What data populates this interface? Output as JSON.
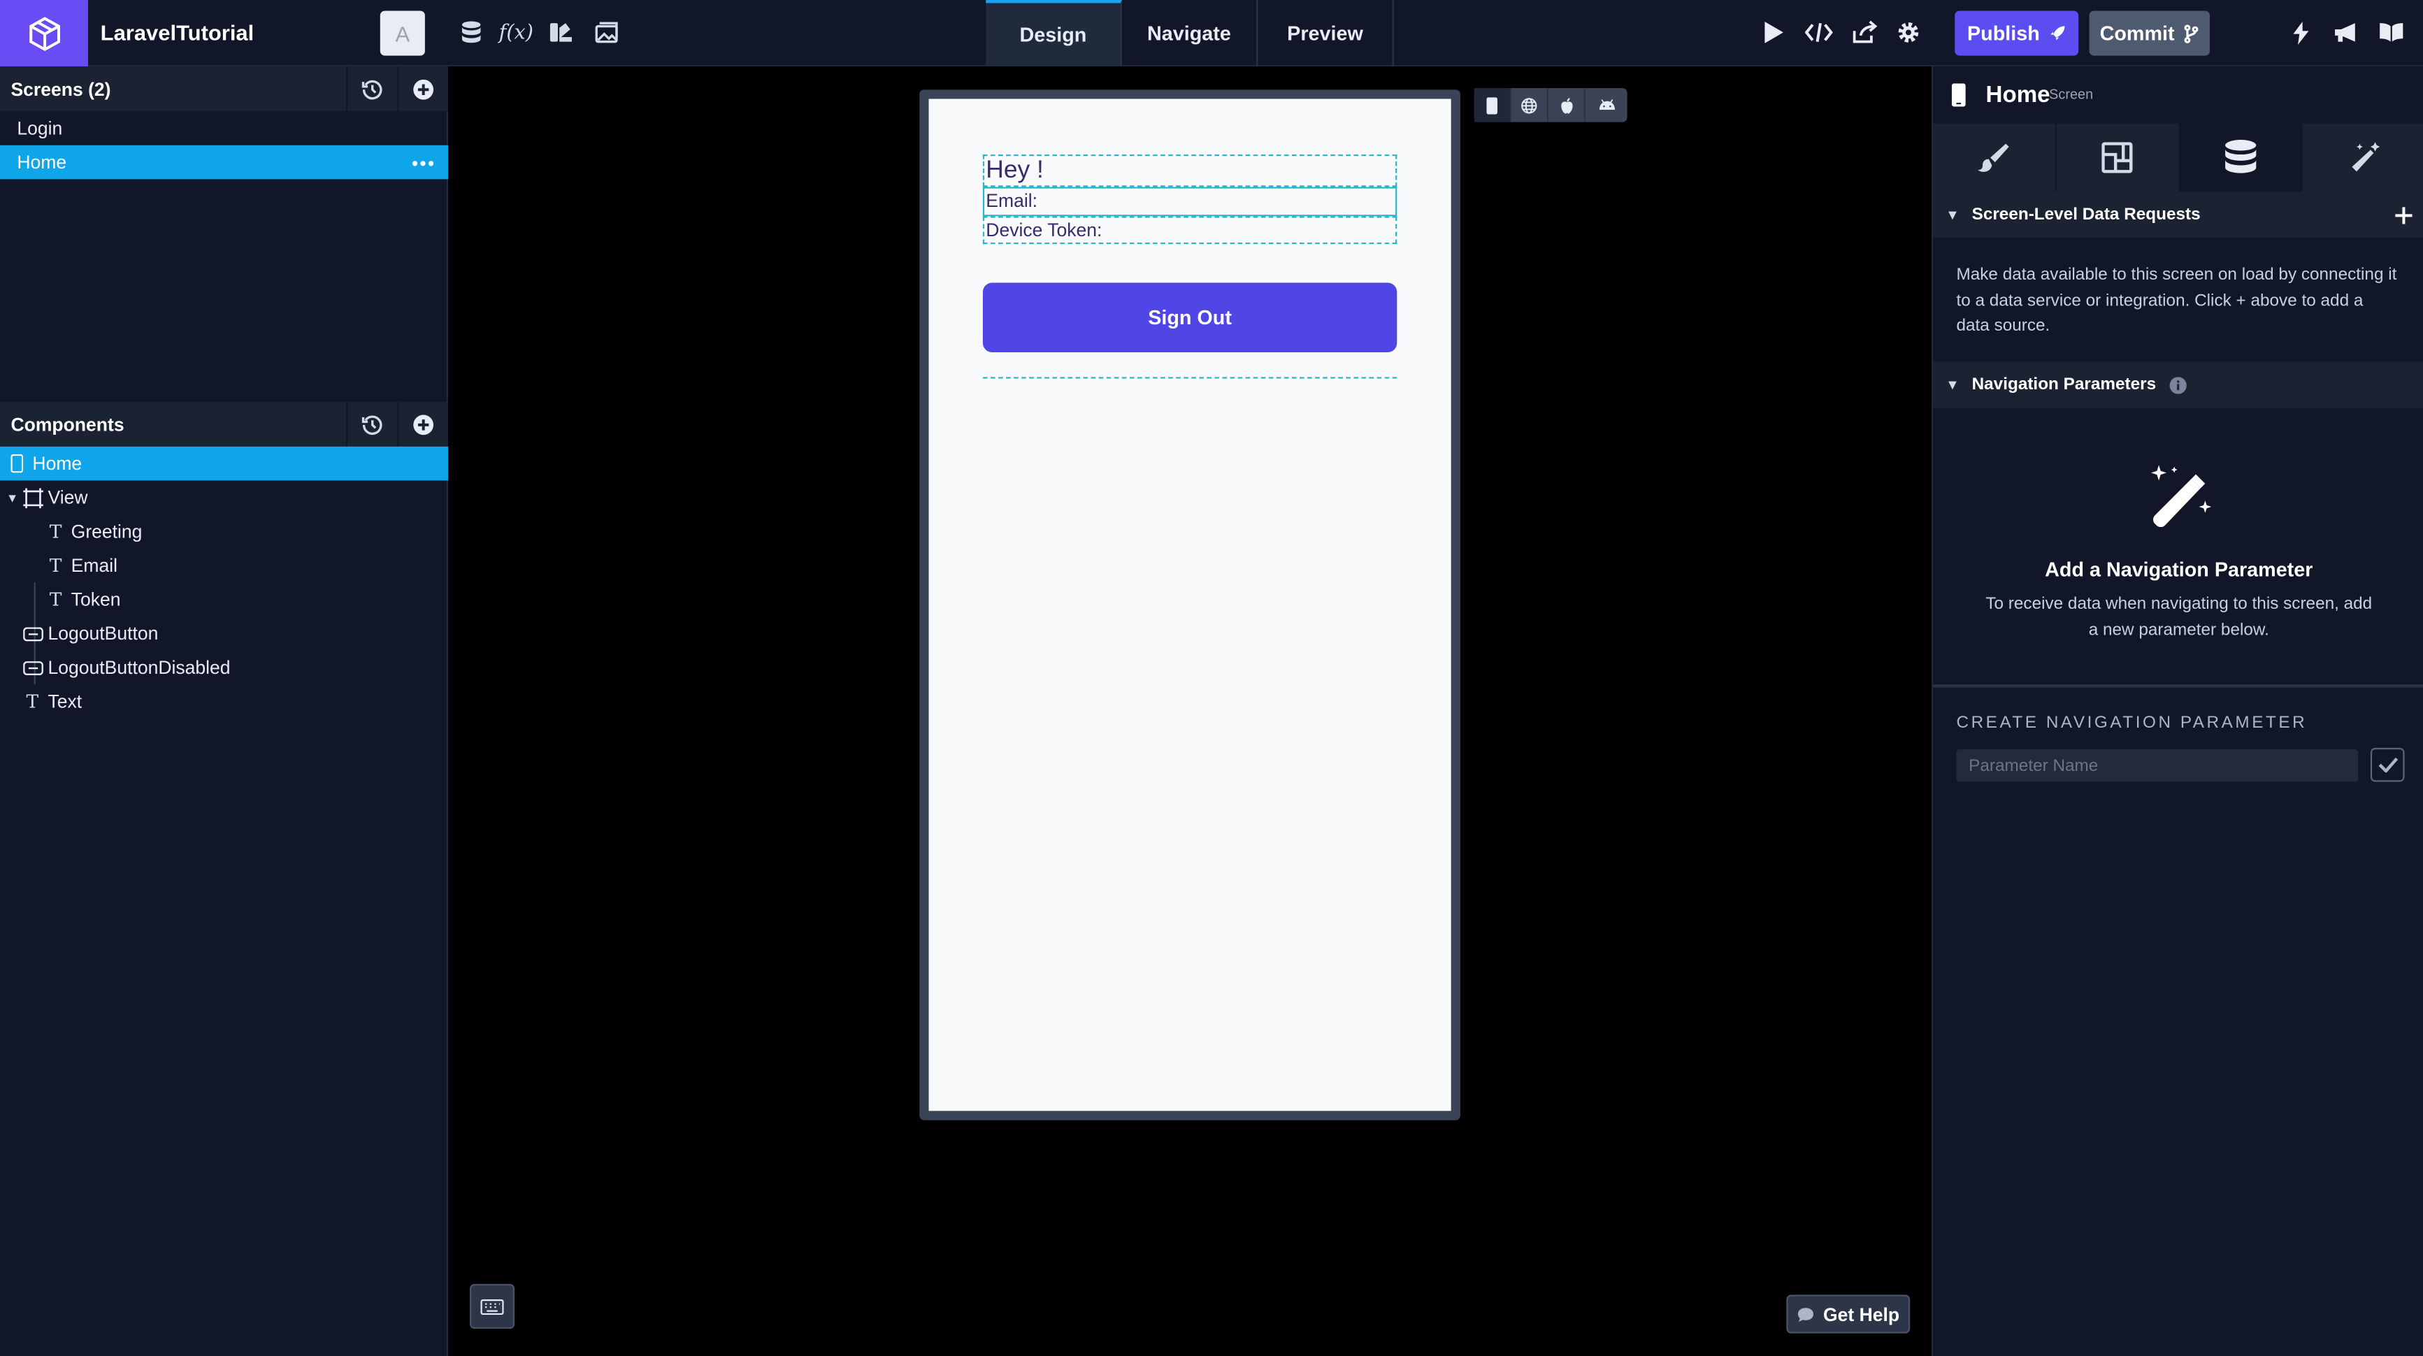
{
  "app": {
    "title": "LaravelTutorial",
    "avatar_initial": "A"
  },
  "toolbar": {
    "icons": [
      "database-icon",
      "function-icon",
      "theme-icon",
      "image-icon"
    ],
    "tabs": [
      {
        "label": "Design",
        "active": true
      },
      {
        "label": "Navigate",
        "active": false
      },
      {
        "label": "Preview",
        "active": false
      }
    ],
    "publish_label": "Publish",
    "commit_label": "Commit"
  },
  "screens": {
    "title": "Screens (2)",
    "items": [
      {
        "label": "Login",
        "selected": false
      },
      {
        "label": "Home",
        "selected": true
      }
    ]
  },
  "components": {
    "title": "Components",
    "items": [
      {
        "label": "Home",
        "type": "screen",
        "selected": true
      },
      {
        "label": "View",
        "type": "view"
      },
      {
        "label": "Greeting",
        "type": "text"
      },
      {
        "label": "Email",
        "type": "text"
      },
      {
        "label": "Token",
        "type": "text"
      },
      {
        "label": "LogoutButton",
        "type": "button"
      },
      {
        "label": "LogoutButtonDisabled",
        "type": "button"
      },
      {
        "label": "Text",
        "type": "text"
      }
    ]
  },
  "canvas": {
    "greeting": "Hey !",
    "email": "Email:",
    "token": "Device Token:",
    "button": "Sign Out",
    "platforms": [
      "phone-icon",
      "web-icon",
      "apple-icon",
      "android-icon"
    ],
    "help_label": "Get Help"
  },
  "inspector": {
    "title": "Home",
    "subtitle": "Screen",
    "tabs": [
      "style-icon",
      "layout-icon",
      "data-icon",
      "magic-icon"
    ],
    "active_tab": 2,
    "data_requests": {
      "title": "Screen-Level Data Requests",
      "description": "Make data available to this screen on load by connecting it to a data service or integration. Click + above to add a data source."
    },
    "nav_params": {
      "title": "Navigation Parameters",
      "empty_title": "Add a Navigation Parameter",
      "empty_text": "To receive data when navigating to this screen, add a new parameter below.",
      "create_label": "CREATE NAVIGATION PARAMETER",
      "input_placeholder": "Parameter Name",
      "input_value": ""
    }
  },
  "colors": {
    "accent": "#0ea5e9",
    "brand": "#6a4cf5",
    "publish": "#5b4df0",
    "button": "#4f46e5"
  }
}
